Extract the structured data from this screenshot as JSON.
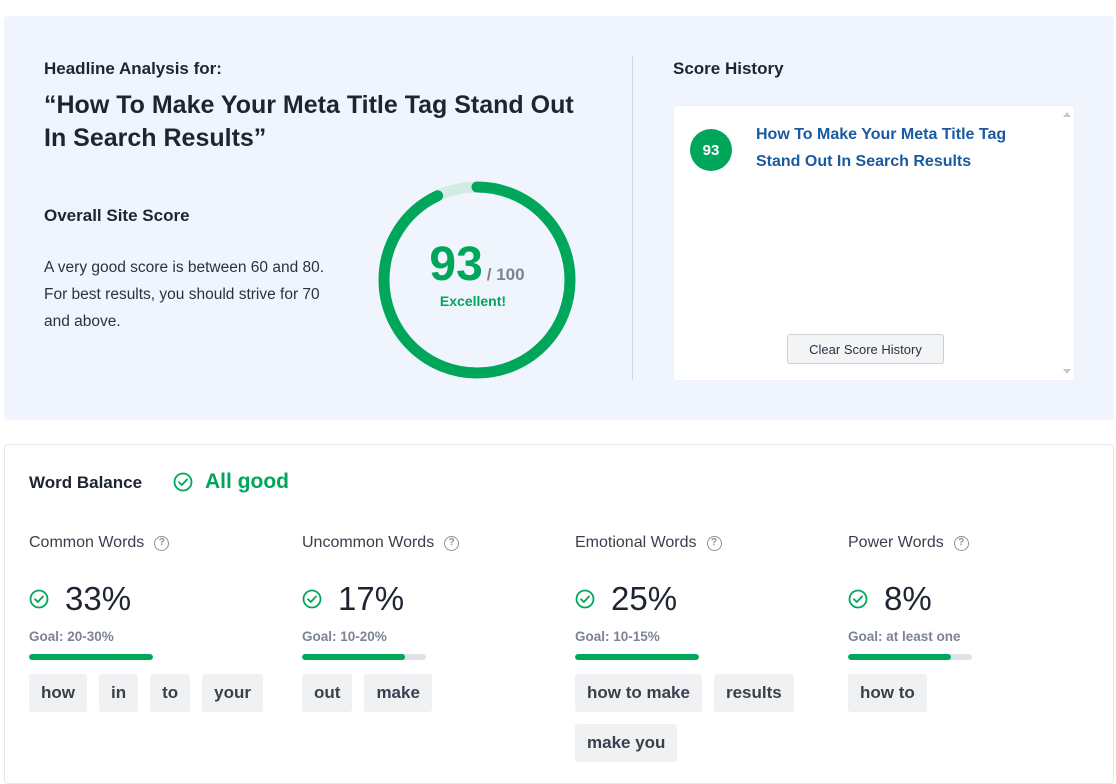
{
  "headline": {
    "label": "Headline Analysis for:",
    "title": "“How To Make Your Meta Title Tag Stand Out In Search Results”"
  },
  "site_score": {
    "label": "Overall Site Score",
    "description": "A very good score is between 60 and 80. For best results, you should strive for 70 and above.",
    "score": "93",
    "max": "/ 100",
    "rating": "Excellent!",
    "fraction": 0.93
  },
  "history": {
    "label": "Score History",
    "items": [
      {
        "score": "93",
        "title": "How To Make Your Meta Title Tag Stand Out In Search Results"
      }
    ],
    "clear_label": "Clear Score History"
  },
  "word_balance": {
    "title": "Word Balance",
    "status": "All good",
    "columns": [
      {
        "name": "Common Words",
        "percent": "33%",
        "goal": "Goal: 20-30%",
        "fill": 1.0,
        "words": [
          "how",
          "in",
          "to",
          "your"
        ]
      },
      {
        "name": "Uncommon Words",
        "percent": "17%",
        "goal": "Goal: 10-20%",
        "fill": 0.83,
        "words": [
          "out",
          "make"
        ]
      },
      {
        "name": "Emotional Words",
        "percent": "25%",
        "goal": "Goal: 10-15%",
        "fill": 1.0,
        "words": [
          "how to make",
          "results",
          "make you"
        ]
      },
      {
        "name": "Power Words",
        "percent": "8%",
        "goal": "Goal: at least one",
        "fill": 0.83,
        "words": [
          "how to"
        ]
      }
    ]
  },
  "colors": {
    "accent": "#00a65a",
    "link": "#1a5aa0",
    "panel": "#f0f5fd"
  },
  "icons": {
    "check": "check-circle-icon",
    "help": "question-circle-icon"
  }
}
